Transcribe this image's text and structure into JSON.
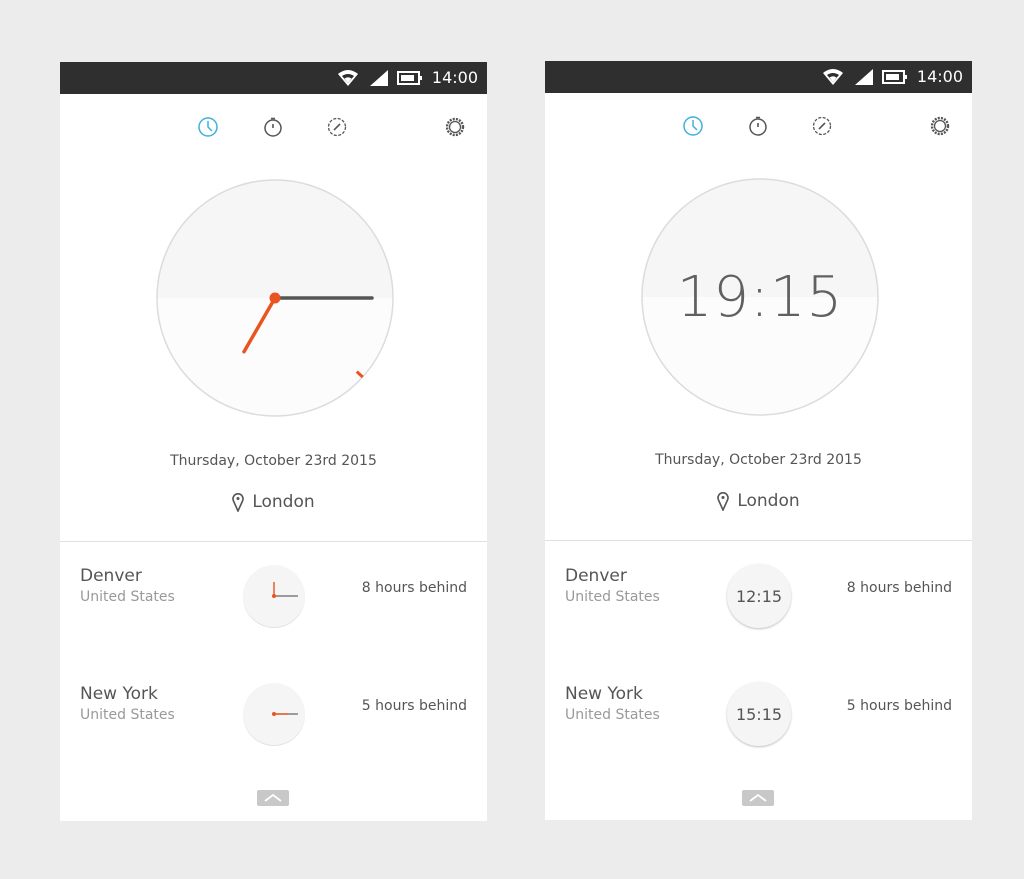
{
  "accent_color": "#3fb0e0",
  "hand_color": "#e95420",
  "phones": [
    {
      "mode": "analog",
      "status_bar": {
        "time": "14:00",
        "icons": [
          "wifi-icon",
          "signal-icon",
          "battery-icon"
        ]
      },
      "tabs": [
        {
          "icon": "clock-icon",
          "active": true
        },
        {
          "icon": "stopwatch-icon",
          "active": false
        },
        {
          "icon": "timer-icon",
          "active": false
        },
        {
          "icon": "settings-gear-icon",
          "active": false
        }
      ],
      "main_clock": {
        "time": "19:15",
        "seconds": 22
      },
      "date": "Thursday, October 23rd 2015",
      "location": "London",
      "cities": [
        {
          "city": "Denver",
          "country": "United States",
          "time": "12:15",
          "offset": "8 hours behind"
        },
        {
          "city": "New York",
          "country": "United States",
          "time": "15:15",
          "offset": "5 hours behind"
        }
      ]
    },
    {
      "mode": "digital",
      "status_bar": {
        "time": "14:00",
        "icons": [
          "wifi-icon",
          "signal-icon",
          "battery-icon"
        ]
      },
      "tabs": [
        {
          "icon": "clock-icon",
          "active": true
        },
        {
          "icon": "stopwatch-icon",
          "active": false
        },
        {
          "icon": "timer-icon",
          "active": false
        },
        {
          "icon": "settings-gear-icon",
          "active": false
        }
      ],
      "main_clock": {
        "time": "19:15"
      },
      "date": "Thursday, October 23rd 2015",
      "location": "London",
      "cities": [
        {
          "city": "Denver",
          "country": "United States",
          "time": "12:15",
          "offset": "8 hours behind"
        },
        {
          "city": "New York",
          "country": "United States",
          "time": "15:15",
          "offset": "5 hours behind"
        }
      ]
    }
  ]
}
